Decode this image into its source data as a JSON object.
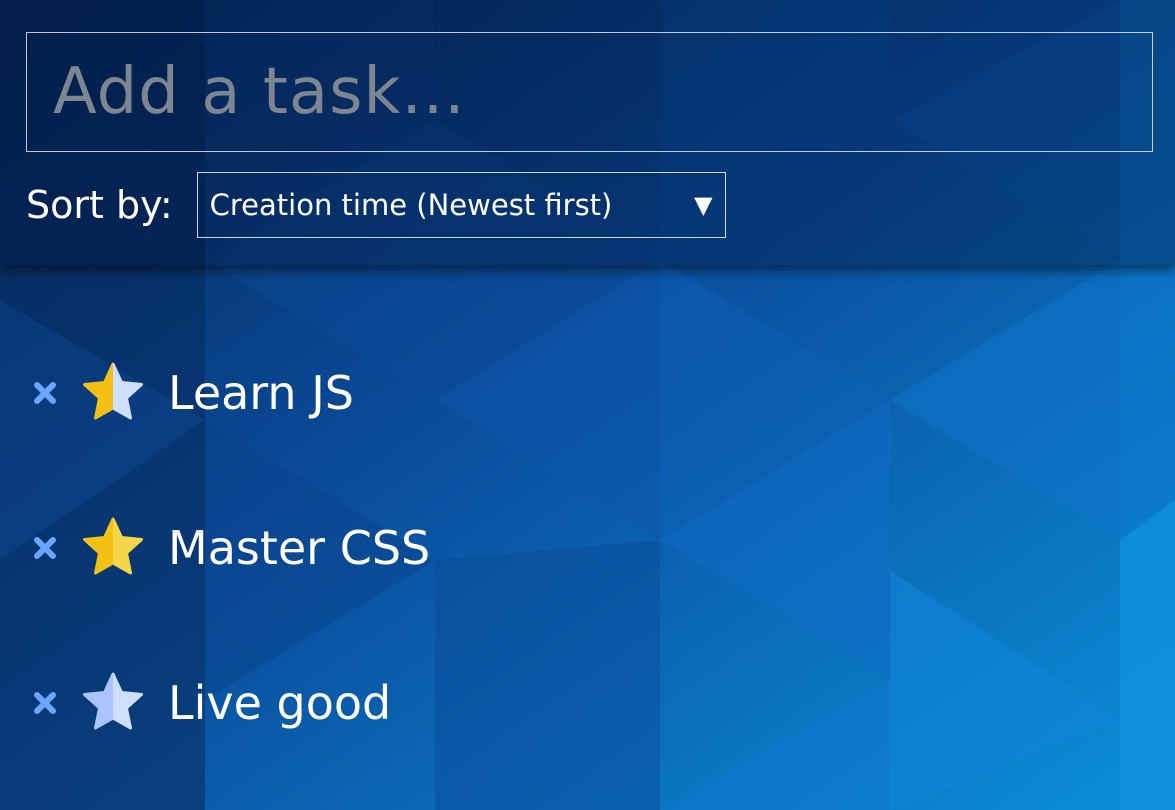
{
  "task_input": {
    "placeholder": "Add a task...",
    "value": ""
  },
  "sort": {
    "label": "Sort by:",
    "selected": "Creation time (Newest first)",
    "caret": "▼"
  },
  "tasks": [
    {
      "text": "Learn JS",
      "star_state": "half"
    },
    {
      "text": "Master CSS",
      "star_state": "full"
    },
    {
      "text": "Live good",
      "star_state": "empty"
    }
  ],
  "icons": {
    "delete": "close-icon",
    "priority": "star-icon"
  },
  "colors": {
    "background_deep": "#0a2f6b",
    "background_mid": "#0a4d9c",
    "background_light": "#0b8fd8",
    "delete_icon": "#6aa6ff",
    "star_gold": "#f2c113",
    "star_gold_light": "#f5d64a",
    "star_empty": "#a9c4ff",
    "star_empty_light": "#cfdfff",
    "placeholder": "#7d8590"
  }
}
